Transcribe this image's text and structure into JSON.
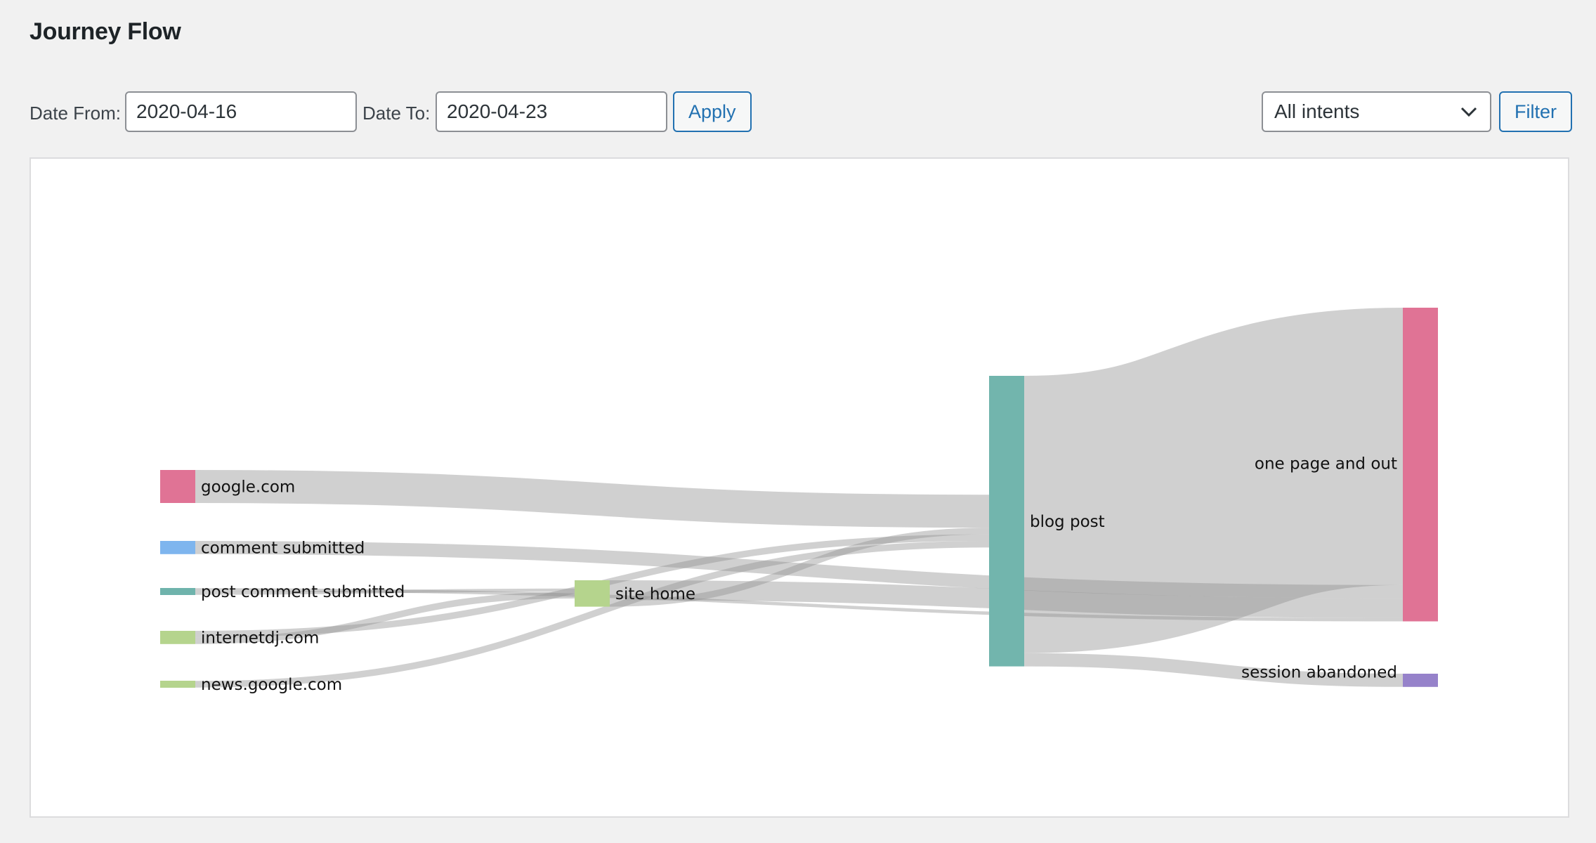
{
  "page": {
    "title": "Journey Flow"
  },
  "filters": {
    "date_from_label": "Date From:",
    "date_from_value": "2020-04-16",
    "date_to_label": "Date To:",
    "date_to_value": "2020-04-23",
    "apply_label": "Apply",
    "intent_select_value": "All intents",
    "filter_label": "Filter"
  },
  "chart_data": {
    "type": "sankey",
    "nodes": [
      {
        "id": "google",
        "label": "google.com",
        "color": "#e07395"
      },
      {
        "id": "comment",
        "label": "comment submitted",
        "color": "#7eb5ee"
      },
      {
        "id": "postcomment",
        "label": "post comment submitted",
        "color": "#6fb3ac"
      },
      {
        "id": "internetdj",
        "label": "internetdj.com",
        "color": "#b5d48d"
      },
      {
        "id": "newsgoogle",
        "label": "news.google.com",
        "color": "#b5d48d"
      },
      {
        "id": "sitehome",
        "label": "site home",
        "color": "#b5d48d"
      },
      {
        "id": "blogpost",
        "label": "blog post",
        "color": "#72b5ad"
      },
      {
        "id": "onepage",
        "label": "one page and out",
        "color": "#e07395"
      },
      {
        "id": "abandoned",
        "label": "session abandoned",
        "color": "#9682ca"
      }
    ],
    "links": [
      {
        "source": "google",
        "target": "blogpost",
        "value": 10
      },
      {
        "source": "comment",
        "target": "onepage",
        "value": 4
      },
      {
        "source": "postcomment",
        "target": "sitehome",
        "value": 1
      },
      {
        "source": "postcomment",
        "target": "onepage",
        "value": 1
      },
      {
        "source": "internetdj",
        "target": "blogpost",
        "value": 2
      },
      {
        "source": "internetdj",
        "target": "sitehome",
        "value": 2
      },
      {
        "source": "newsgoogle",
        "target": "blogpost",
        "value": 2
      },
      {
        "source": "sitehome",
        "target": "blogpost",
        "value": 2
      },
      {
        "source": "sitehome",
        "target": "onepage",
        "value": 6
      },
      {
        "source": "blogpost",
        "target": "onepage",
        "value": 84
      },
      {
        "source": "blogpost",
        "target": "abandoned",
        "value": 4
      }
    ]
  }
}
